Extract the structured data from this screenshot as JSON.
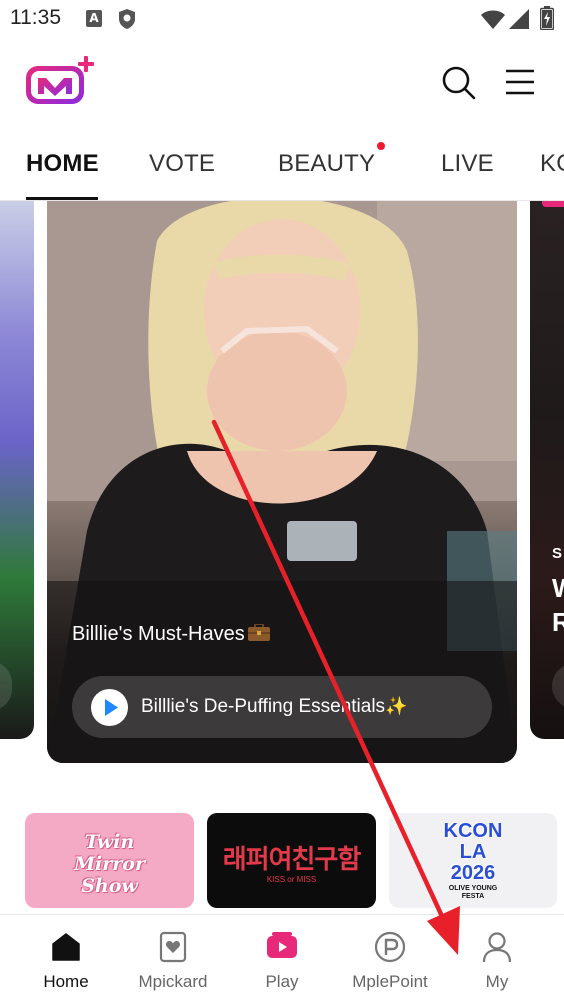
{
  "status_bar": {
    "time": "11:35",
    "notification_letter": "A"
  },
  "header": {
    "logo_icon": "mnet-plus-logo",
    "search_icon": "search-icon",
    "menu_icon": "hamburger-menu-icon"
  },
  "tabs": [
    {
      "label": "HOME",
      "active": true
    },
    {
      "label": "VOTE",
      "active": false
    },
    {
      "label": "BEAUTY",
      "active": false,
      "has_dot": true
    },
    {
      "label": "LIVE",
      "active": false
    },
    {
      "label": "KO",
      "active": false
    }
  ],
  "carousel": {
    "main_card": {
      "title": "Billlie's Must-Haves",
      "title_icon": "briefcase-emoji",
      "pill_text": "Billlie's De-Puffing Essentials",
      "pill_icon": "sparkles-emoji"
    },
    "right_card": {
      "line1": "S",
      "line2": "W",
      "line3": "R"
    }
  },
  "banners": [
    {
      "name": "twin-mirror-show",
      "text_line1": "Twin",
      "text_line2": "Mirror",
      "text_line3": "Show"
    },
    {
      "name": "korean-title-banner",
      "text": "래퍼여친구함",
      "sub": "KISS or MISS"
    },
    {
      "name": "kcon-la-2026",
      "text_line1": "KCON",
      "text_line2": "LA",
      "text_line3": "2026",
      "sub_line1": "OLIVE YOUNG",
      "sub_line2": "FESTA"
    }
  ],
  "bottom_nav": [
    {
      "label": "Home",
      "icon": "home-icon",
      "active": true
    },
    {
      "label": "Mpickard",
      "icon": "mpickard-icon",
      "active": false
    },
    {
      "label": "Play",
      "icon": "play-icon",
      "active": false
    },
    {
      "label": "MplePoint",
      "icon": "mplepoint-icon",
      "active": false
    },
    {
      "label": "My",
      "icon": "user-icon",
      "active": false
    }
  ],
  "colors": {
    "brand_pink": "#e8297a",
    "brand_purple": "#8a2be2",
    "notification_dot": "#ef1c2c",
    "play_blue": "#1e88ff",
    "annotation_red": "#e8202a"
  }
}
